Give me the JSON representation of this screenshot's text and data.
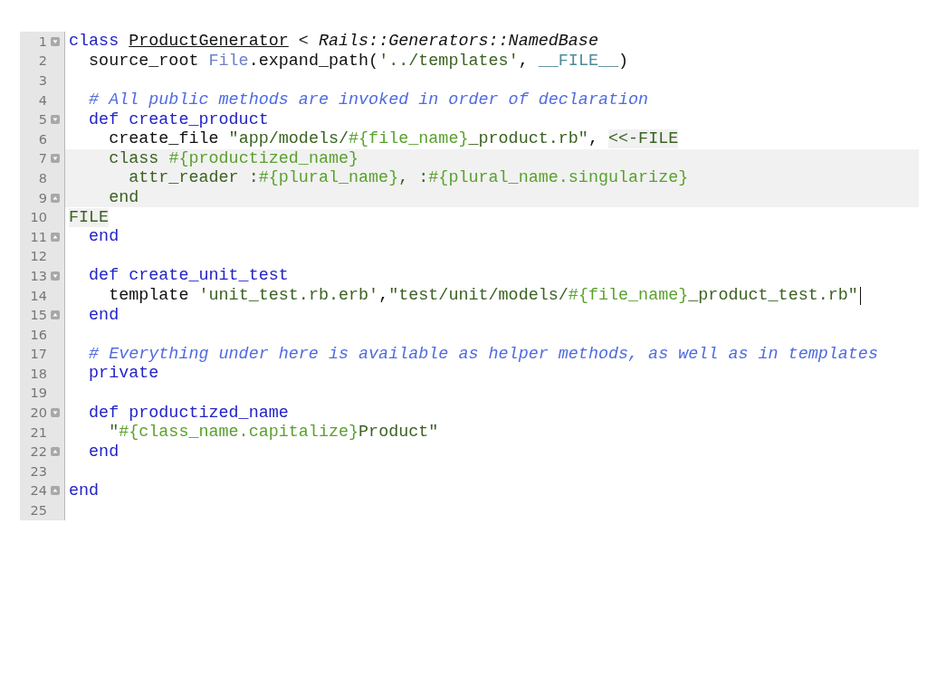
{
  "editor": {
    "lines": [
      {
        "number": "1",
        "fold_start": true,
        "segments": [
          {
            "kind": "keyword",
            "text": "class "
          },
          {
            "kind": "classname",
            "text": "ProductGenerator"
          },
          {
            "kind": "plain",
            "text": " < "
          },
          {
            "kind": "superclass",
            "text": "Rails::Generators::NamedBase"
          }
        ]
      },
      {
        "number": "2",
        "segments": [
          {
            "kind": "plain",
            "text": "  source_root "
          },
          {
            "kind": "constant",
            "text": "File"
          },
          {
            "kind": "plain",
            "text": ".expand_path("
          },
          {
            "kind": "string",
            "text": "'../templates'"
          },
          {
            "kind": "plain",
            "text": ", "
          },
          {
            "kind": "special",
            "text": "__FILE__"
          },
          {
            "kind": "plain",
            "text": ")"
          }
        ]
      },
      {
        "number": "3"
      },
      {
        "number": "4",
        "segments": [
          {
            "kind": "comment",
            "text": "  # All public methods are invoked in order of declaration"
          }
        ]
      },
      {
        "number": "5",
        "fold_start": true,
        "segments": [
          {
            "kind": "keyword",
            "text": "  def create_product"
          }
        ]
      },
      {
        "number": "6",
        "segments": [
          {
            "kind": "plain",
            "text": "    create_file "
          },
          {
            "kind": "string",
            "text": "\"app/models/"
          },
          {
            "kind": "interp",
            "text": "#{file_name}"
          },
          {
            "kind": "string",
            "text": "_product.rb\""
          },
          {
            "kind": "plain",
            "text": ", "
          },
          {
            "kind": "heredoc",
            "text": "<<-FILE"
          }
        ]
      },
      {
        "number": "7",
        "fold_start": true,
        "highlight": true,
        "segments": [
          {
            "kind": "string",
            "text": "    class "
          },
          {
            "kind": "interp",
            "text": "#{productized_name}"
          }
        ]
      },
      {
        "number": "8",
        "highlight": true,
        "segments": [
          {
            "kind": "string",
            "text": "      attr_reader :"
          },
          {
            "kind": "interp",
            "text": "#{plural_name}"
          },
          {
            "kind": "string",
            "text": ", :"
          },
          {
            "kind": "interp",
            "text": "#{plural_name.singularize}"
          }
        ]
      },
      {
        "number": "9",
        "fold_end": true,
        "highlight": true,
        "segments": [
          {
            "kind": "string",
            "text": "    end"
          }
        ]
      },
      {
        "number": "10",
        "segments": [
          {
            "kind": "heredoc",
            "text": "FILE"
          }
        ]
      },
      {
        "number": "11",
        "fold_end": true,
        "segments": [
          {
            "kind": "keyword",
            "text": "  end"
          }
        ]
      },
      {
        "number": "12"
      },
      {
        "number": "13",
        "fold_start": true,
        "segments": [
          {
            "kind": "keyword",
            "text": "  def create_unit_test"
          }
        ]
      },
      {
        "number": "14",
        "cursor": true,
        "segments": [
          {
            "kind": "plain",
            "text": "    template "
          },
          {
            "kind": "string",
            "text": "'unit_test.rb.erb'"
          },
          {
            "kind": "plain",
            "text": ","
          },
          {
            "kind": "string",
            "text": "\"test/unit/models/"
          },
          {
            "kind": "interp",
            "text": "#{file_name}"
          },
          {
            "kind": "string",
            "text": "_product_test.rb\""
          }
        ]
      },
      {
        "number": "15",
        "fold_end": true,
        "segments": [
          {
            "kind": "keyword",
            "text": "  end"
          }
        ]
      },
      {
        "number": "16"
      },
      {
        "number": "17",
        "segments": [
          {
            "kind": "comment",
            "text": "  # Everything under here is available as helper methods, as well as in templates"
          }
        ]
      },
      {
        "number": "18",
        "segments": [
          {
            "kind": "keyword",
            "text": "  private"
          }
        ]
      },
      {
        "number": "19"
      },
      {
        "number": "20",
        "fold_start": true,
        "segments": [
          {
            "kind": "keyword",
            "text": "  def productized_name"
          }
        ]
      },
      {
        "number": "21",
        "segments": [
          {
            "kind": "string",
            "text": "    \""
          },
          {
            "kind": "interp",
            "text": "#{class_name.capitalize}"
          },
          {
            "kind": "string",
            "text": "Product\""
          }
        ]
      },
      {
        "number": "22",
        "fold_end": true,
        "segments": [
          {
            "kind": "keyword",
            "text": "  end"
          }
        ]
      },
      {
        "number": "23"
      },
      {
        "number": "24",
        "fold_end": true,
        "segments": [
          {
            "kind": "keyword",
            "text": "end"
          }
        ]
      },
      {
        "number": "25"
      }
    ]
  }
}
